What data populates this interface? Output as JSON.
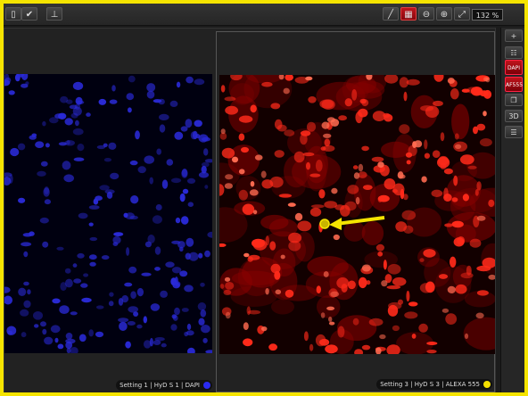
{
  "toolbar": {
    "zoom_value": "132 %",
    "left_icons": [
      "panel-icon",
      "check-icon",
      "split-icon"
    ],
    "right_icons": [
      "pencil-icon",
      "roi-icon",
      "zoom-out-icon",
      "zoom-in-icon",
      "fit-screen-icon"
    ]
  },
  "sidebar": {
    "add_label": "+",
    "channel_dapi": "DAPI",
    "channel_af555": "AF555",
    "view_3d": "3D"
  },
  "panes": [
    {
      "label": "Setting 1 | HyD S 1 | DAPI",
      "dot_color": "#2a2af0"
    },
    {
      "label": "Setting 3 | HyD S 3 | ALEXA 555",
      "dot_color": "#f5e000"
    }
  ],
  "annotation": {
    "arrow_color": "#f5e400"
  }
}
